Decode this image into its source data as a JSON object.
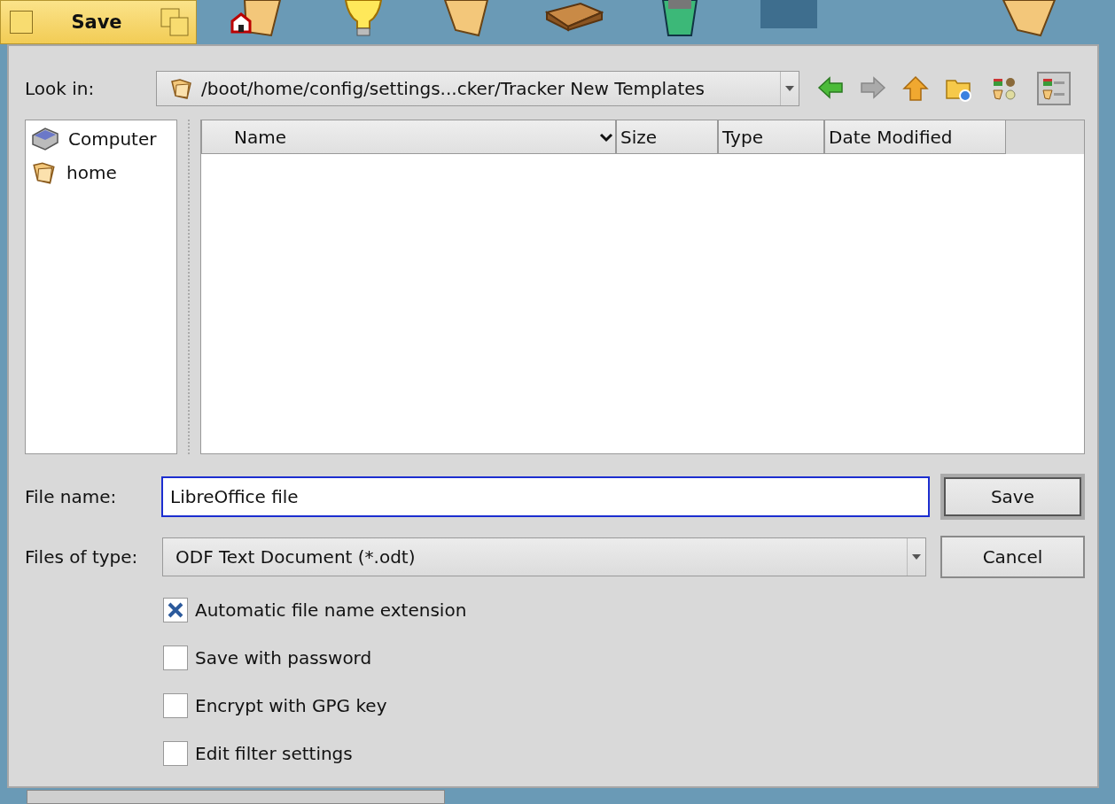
{
  "window_tab": {
    "title": "Save"
  },
  "look_in": {
    "label": "Look in:",
    "path": "/boot/home/config/settings...cker/Tracker New Templates"
  },
  "nav_buttons": [
    {
      "kind": "back",
      "disabled": false
    },
    {
      "kind": "forward",
      "disabled": true
    },
    {
      "kind": "up",
      "disabled": false
    },
    {
      "kind": "new-folder",
      "disabled": false
    }
  ],
  "view_modes": [
    {
      "kind": "icons",
      "selected": false
    },
    {
      "kind": "details",
      "selected": true
    }
  ],
  "places": [
    {
      "label": "Computer",
      "kind": "computer"
    },
    {
      "label": "home",
      "kind": "folder"
    }
  ],
  "file_list": {
    "columns": [
      {
        "label": "Name",
        "sorted": true
      },
      {
        "label": "Size",
        "sorted": false
      },
      {
        "label": "Type",
        "sorted": false
      },
      {
        "label": "Date Modified",
        "sorted": false
      }
    ]
  },
  "file_name": {
    "label": "File name:",
    "value": "LibreOffice file"
  },
  "file_type": {
    "label": "Files of type:",
    "value": "ODF Text Document (*.odt)"
  },
  "buttons": [
    {
      "label": "Save",
      "default": true
    },
    {
      "label": "Cancel",
      "default": false
    }
  ],
  "options": [
    {
      "label": "Automatic file name extension",
      "checked": true
    },
    {
      "label": "Save with password",
      "checked": false
    },
    {
      "label": "Encrypt with GPG key",
      "checked": false
    },
    {
      "label": "Edit filter settings",
      "checked": false
    }
  ]
}
